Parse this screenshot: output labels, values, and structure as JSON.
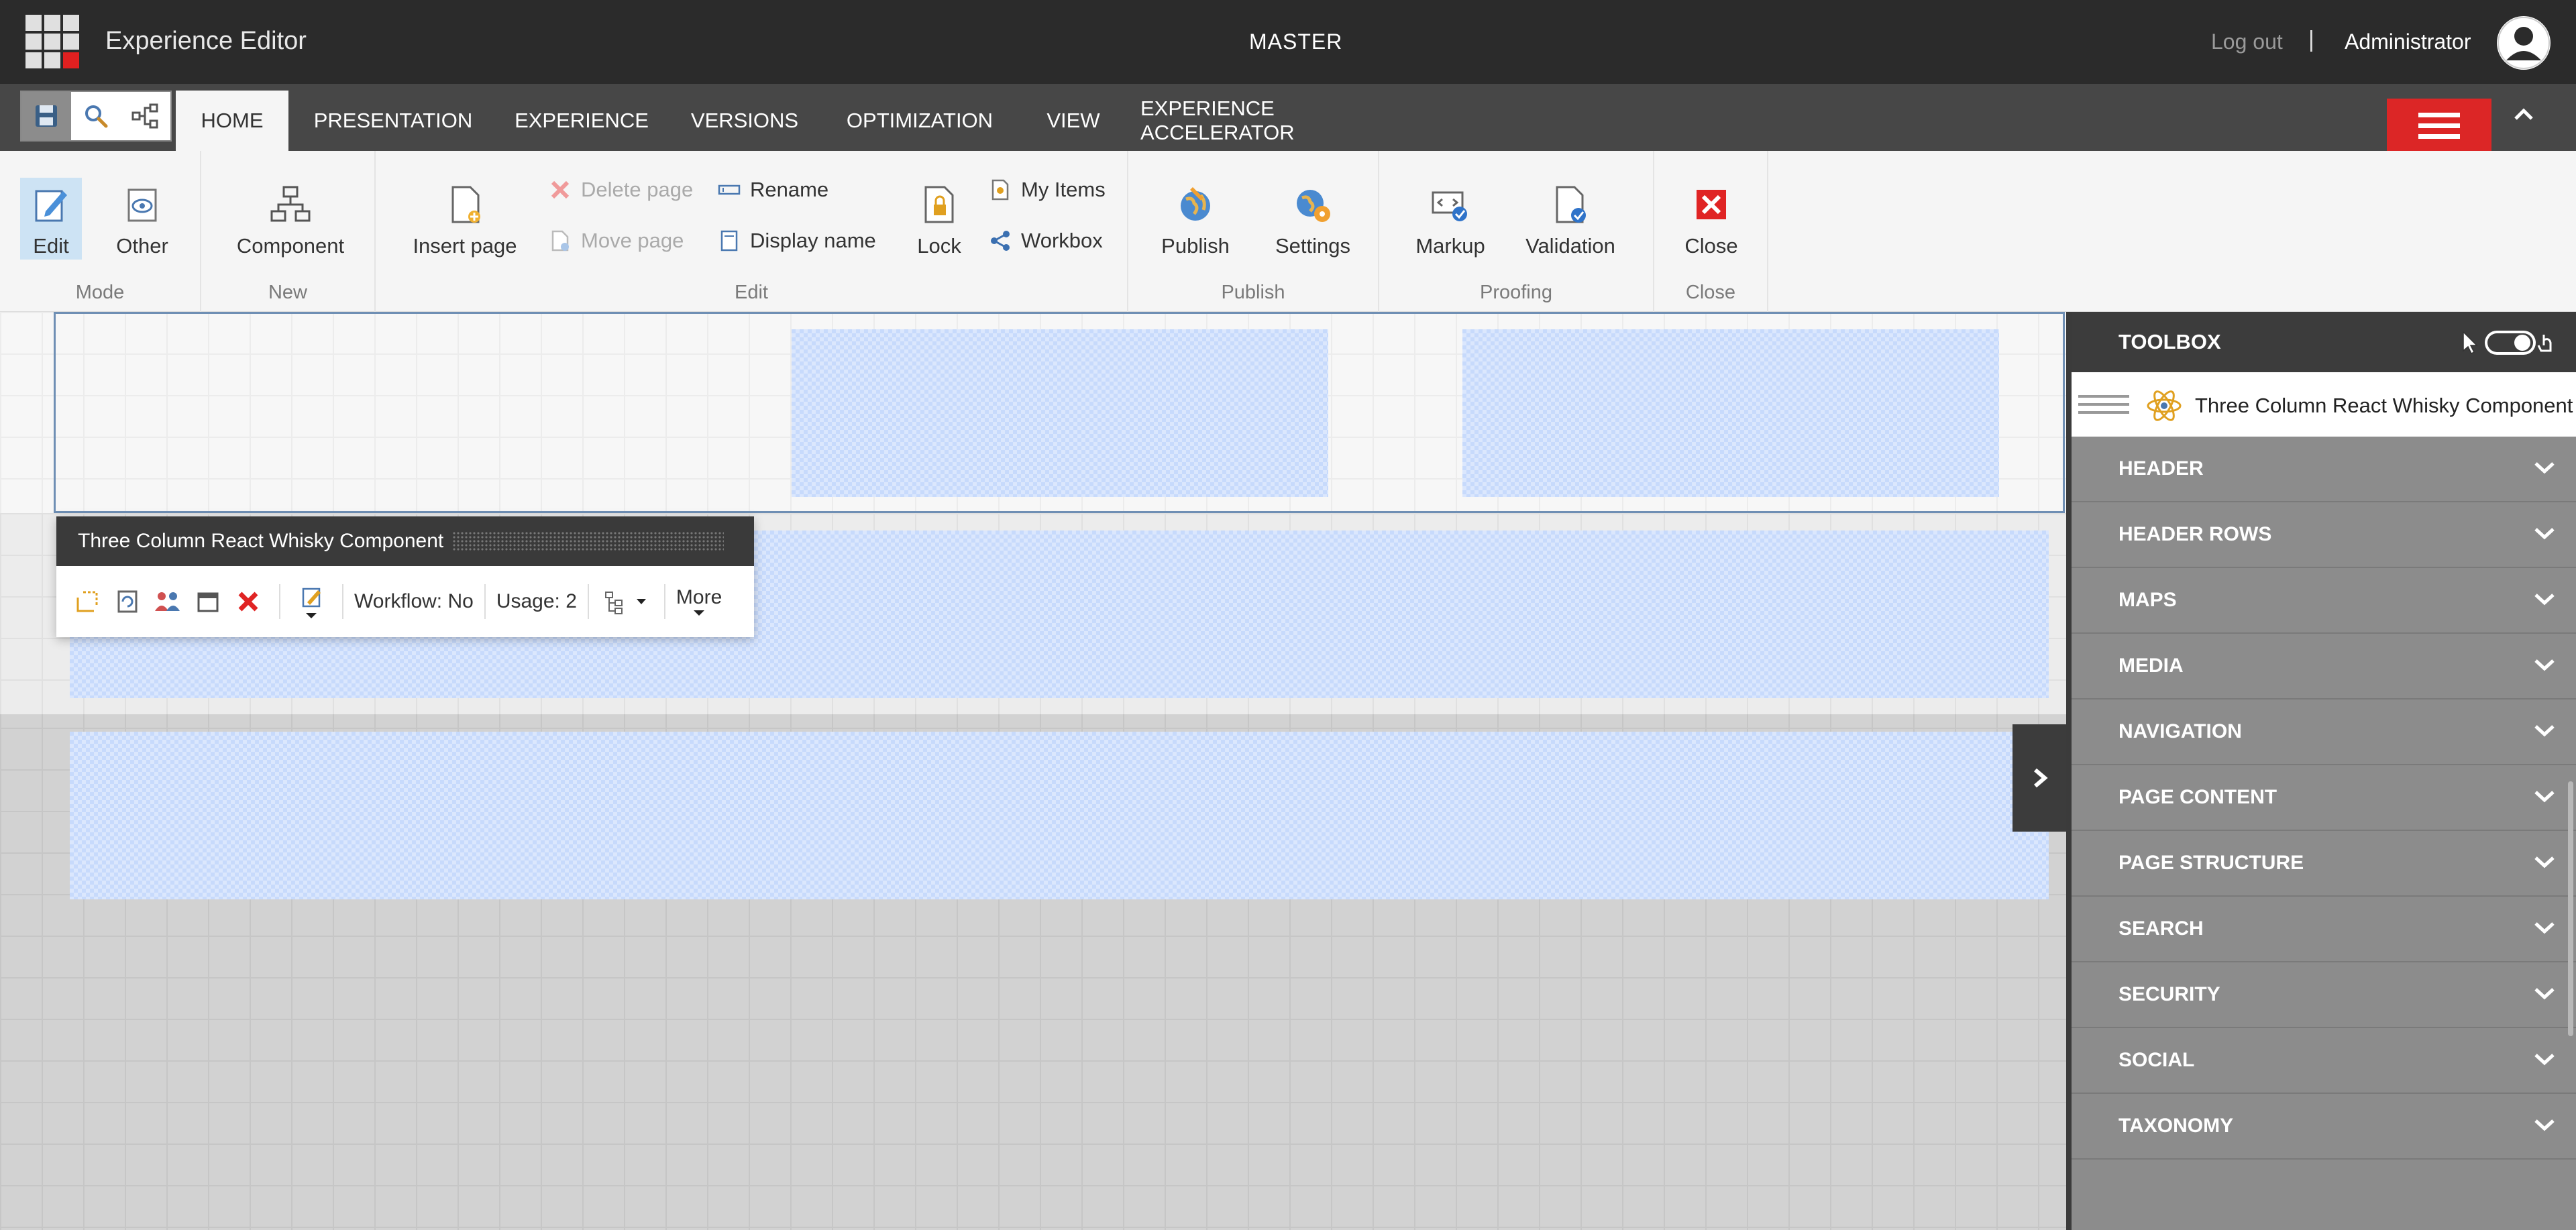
{
  "topbar": {
    "app_title": "Experience Editor",
    "database": "MASTER",
    "logout": "Log out",
    "separator": "|",
    "user": "Administrator"
  },
  "tabs": {
    "home": "HOME",
    "presentation": "PRESENTATION",
    "experience": "EXPERIENCE",
    "versions": "VERSIONS",
    "optimization": "OPTIMIZATION",
    "view": "VIEW",
    "experience_accelerator": "EXPERIENCE ACCELERATOR"
  },
  "ribbon": {
    "mode": {
      "label": "Mode",
      "edit": "Edit",
      "other": "Other"
    },
    "new": {
      "label": "New",
      "component": "Component"
    },
    "edit": {
      "label": "Edit",
      "insert_page": "Insert page",
      "delete_page": "Delete page",
      "move_page": "Move page",
      "rename": "Rename",
      "display_name": "Display name",
      "lock": "Lock",
      "my_items": "My Items",
      "workbox": "Workbox"
    },
    "publish": {
      "label": "Publish",
      "publish": "Publish",
      "settings": "Settings"
    },
    "proofing": {
      "label": "Proofing",
      "markup": "Markup",
      "validation": "Validation"
    },
    "close": {
      "label": "Close",
      "close": "Close"
    }
  },
  "chrome": {
    "title": "Three Column React Whisky Component",
    "workflow": "Workflow: No",
    "usage": "Usage: 2",
    "more": "More"
  },
  "toolbox": {
    "title": "TOOLBOX",
    "component": "Three Column React Whisky Component",
    "categories": [
      "HEADER",
      "HEADER ROWS",
      "MAPS",
      "MEDIA",
      "NAVIGATION",
      "PAGE CONTENT",
      "PAGE STRUCTURE",
      "SEARCH",
      "SECURITY",
      "SOCIAL",
      "TAXONOMY"
    ]
  },
  "colors": {
    "topbar": "#2b2b2b",
    "tabrow": "#474747",
    "accent_red": "#dc2626",
    "placeholder_blue": "#c7dafc",
    "toolbox_bg": "#8c8c8c"
  }
}
